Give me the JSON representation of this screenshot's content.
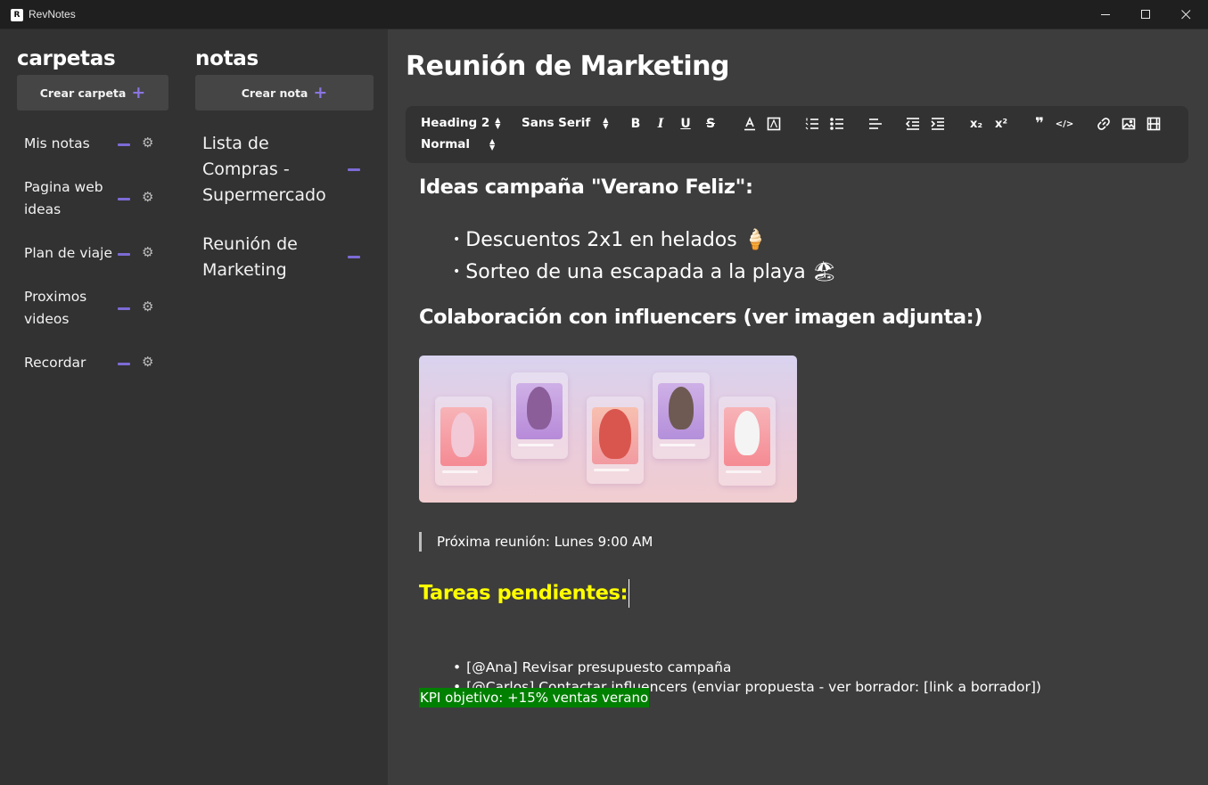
{
  "window": {
    "title": "RevNotes"
  },
  "folders": {
    "title": "carpetas",
    "create_label": "Crear carpeta",
    "items": [
      {
        "label": "Mis notas"
      },
      {
        "label": "Pagina web ideas"
      },
      {
        "label": "Plan de viaje"
      },
      {
        "label": "Proximos videos"
      },
      {
        "label": "Recordar"
      }
    ]
  },
  "notes": {
    "title": "notas",
    "create_label": "Crear nota",
    "items": [
      {
        "label": "Lista de Compras - Supermercado"
      },
      {
        "label": "Reunión de Marketing"
      }
    ]
  },
  "editor": {
    "title": "Reunión de Marketing",
    "toolbar": {
      "heading_select": "Heading 2",
      "font_select": "Sans Serif",
      "size_select": "Normal",
      "bold": "B",
      "italic": "I",
      "underline": "U",
      "strike": "S",
      "subscript": "x₂",
      "superscript": "x²",
      "blockquote": "❞",
      "code": "</>"
    },
    "content": {
      "heading_campaign": "Ideas campaña \"Verano Feliz\":",
      "ideas": [
        "Descuentos 2x1 en helados 🍦",
        "Sorteo de una escapada a la playa 🏖"
      ],
      "heading_collab": "Colaboración con influencers (ver imagen adjunta:)",
      "quote": "Próxima reunión: Lunes 9:00 AM",
      "heading_tasks": "Tareas pendientes:",
      "tasks": [
        "[@Ana] Revisar presupuesto campaña",
        "[@Carlos] Contactar influencers (enviar propuesta - ver borrador: [link a borrador])"
      ],
      "kpi": "KPI objetivo: +15% ventas verano"
    }
  },
  "colors": {
    "accent": "#7c6bd6",
    "sidebar_bg": "#323232",
    "editor_bg": "#3d3d3d",
    "tasks_heading": "#ffff00",
    "kpi_highlight": "#008000"
  }
}
